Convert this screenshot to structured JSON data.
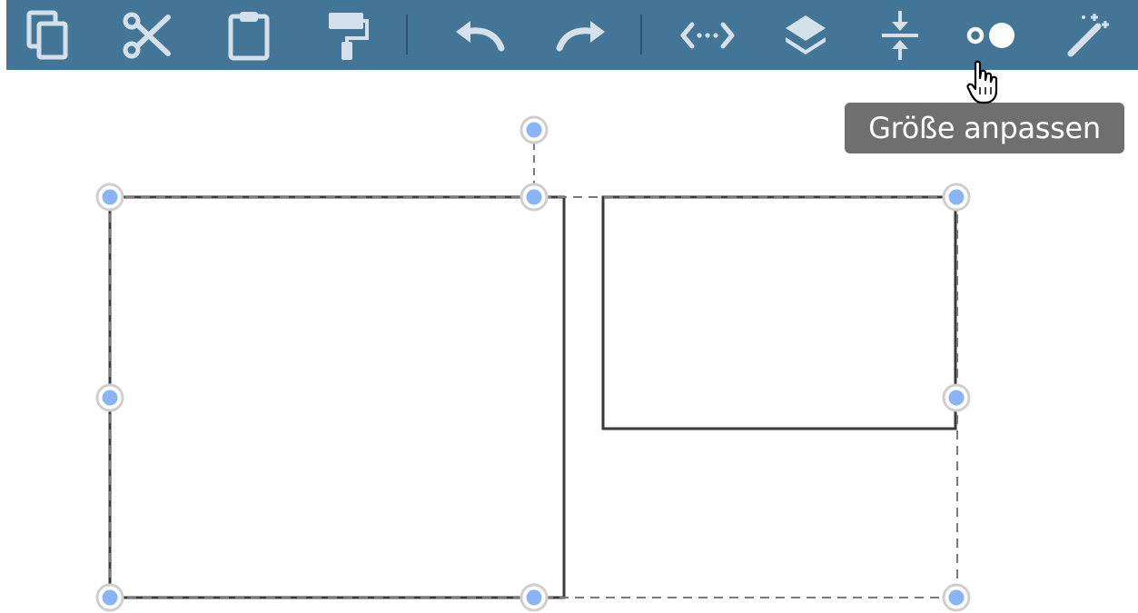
{
  "toolbar": {
    "background": "#437597",
    "icon_color": "#d5e1ea",
    "buttons": [
      {
        "name": "copy",
        "icon": "copy-icon"
      },
      {
        "name": "cut",
        "icon": "scissors-icon"
      },
      {
        "name": "paste",
        "icon": "clipboard-icon"
      },
      {
        "name": "format-painter",
        "icon": "paint-roller-icon"
      },
      {
        "name": "undo",
        "icon": "undo-icon"
      },
      {
        "name": "redo",
        "icon": "redo-icon"
      },
      {
        "name": "distribute",
        "icon": "distribute-horizontal-icon"
      },
      {
        "name": "arrange",
        "icon": "layers-icon"
      },
      {
        "name": "compact",
        "icon": "compress-vertical-icon"
      },
      {
        "name": "resize",
        "icon": "resize-dots-icon"
      },
      {
        "name": "magic",
        "icon": "magic-wand-icon"
      }
    ]
  },
  "tooltip": {
    "text": "Größe anpassen"
  },
  "selection": {
    "handle_color": "#8ab4f8",
    "handle_ring_color": "#d0d0d0"
  }
}
